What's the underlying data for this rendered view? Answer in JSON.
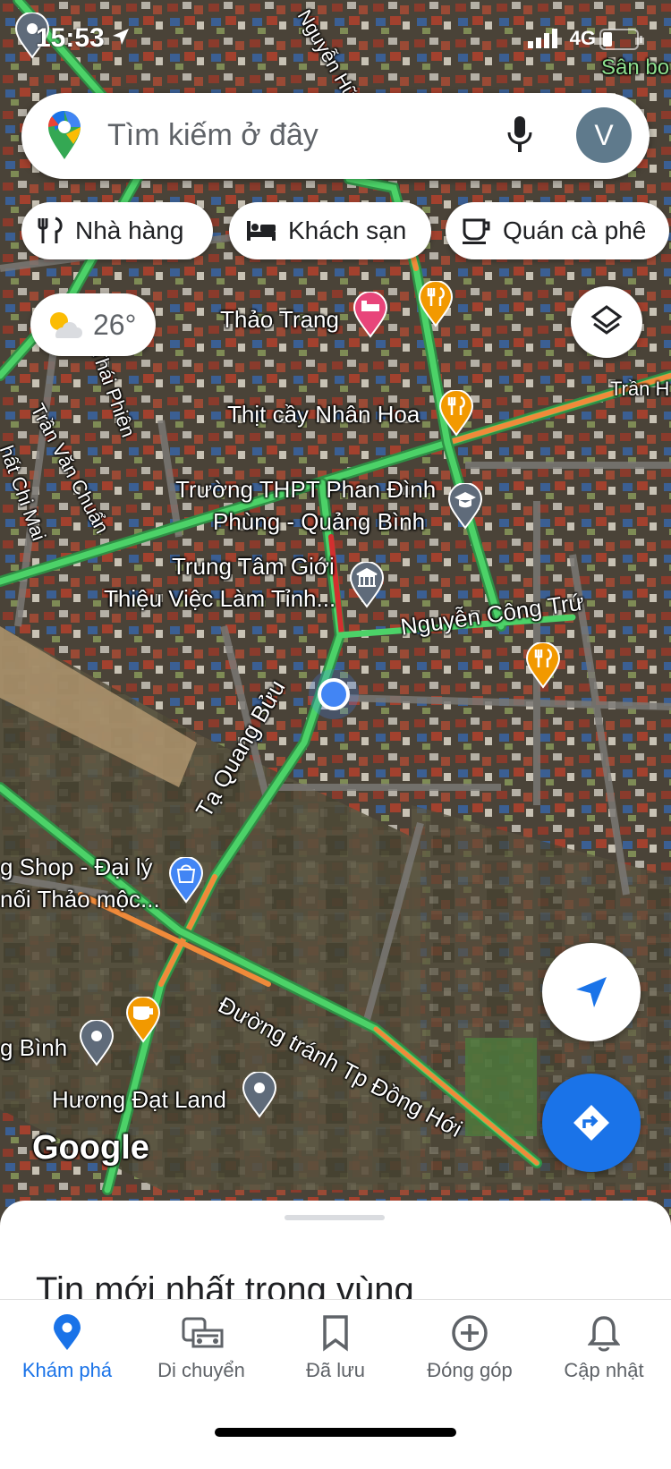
{
  "status": {
    "time": "15:53",
    "network": "4G"
  },
  "search": {
    "placeholder": "Tìm kiếm ở đây",
    "avatar_letter": "V"
  },
  "chips": [
    {
      "label": "Nhà hàng",
      "icon": "restaurant-icon"
    },
    {
      "label": "Khách sạn",
      "icon": "hotel-icon"
    },
    {
      "label": "Quán cà phê",
      "icon": "cafe-icon"
    }
  ],
  "weather": {
    "temp": "26°",
    "icon": "partly-cloudy-icon"
  },
  "map_labels": {
    "thao_trang": "Thảo Trang",
    "thit_cay": "Thịt cầy Nhân Hoa",
    "truong_1": "Trường THPT Phan Đình",
    "truong_2": "Phùng - Quảng Bình",
    "trung_tam_1": "Trung Tâm Giới",
    "trung_tam_2": "Thiệu Việc Làm Tỉnh...",
    "nguyen_cong_tru": "Nguyễn Công Trứ",
    "ta_quang_buu": "Tạ Quang Bửu",
    "shop_1": "g Shop - Đại lý",
    "shop_2": "nối Thảo mộc...",
    "duong_tranh": "Đường tránh Tp Đồng Hới",
    "g_binh": "g Bình",
    "huong_dat": "Hương Đạt Land",
    "tran_van_chuan": "Trần Văn Chuẩn",
    "thai_phien": "Thái Phiên",
    "tran_h": "Trần H",
    "san_bo": "Sân bo",
    "nguyen_huu": "Nguyễn Hữu",
    "chi_mai": "hất Chi Mai",
    "google": "Google"
  },
  "sheet": {
    "title": "Tin mới nhất trong vùng"
  },
  "bottom_nav": [
    {
      "label": "Khám phá",
      "icon": "explore-pin-icon",
      "active": true
    },
    {
      "label": "Di chuyển",
      "icon": "commute-icon",
      "active": false
    },
    {
      "label": "Đã lưu",
      "icon": "bookmark-icon",
      "active": false
    },
    {
      "label": "Đóng góp",
      "icon": "add-circle-icon",
      "active": false
    },
    {
      "label": "Cập nhật",
      "icon": "bell-icon",
      "active": false
    }
  ],
  "colors": {
    "accent": "#1a73e8",
    "traffic_green": "#3cc35b",
    "traffic_orange": "#f08a3a",
    "traffic_red": "#d32f2f",
    "pin_orange": "#f29900",
    "pin_pink": "#e8457a"
  }
}
